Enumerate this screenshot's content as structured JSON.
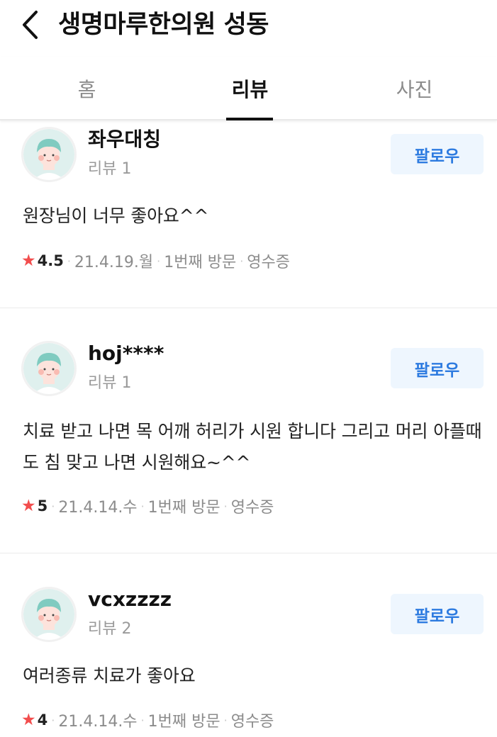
{
  "header": {
    "title": "생명마루한의원 성동"
  },
  "tabs": [
    {
      "label": "홈"
    },
    {
      "label": "리뷰"
    },
    {
      "label": "사진"
    }
  ],
  "reviews": [
    {
      "username": "좌우대칭",
      "review_count": "리뷰 1",
      "follow_label": "팔로우",
      "text": "원장님이 너무 좋아요^^",
      "rating": "4.5",
      "date": "21.4.19.월",
      "visit": "1번째 방문",
      "receipt": "영수증"
    },
    {
      "username": "hoj****",
      "review_count": "리뷰 1",
      "follow_label": "팔로우",
      "text": "치료 받고 나면 목 어깨 허리가 시원 합니다 그리고 머리 아플때도 침 맞고 나면 시원해요~^^",
      "rating": "5",
      "date": "21.4.14.수",
      "visit": "1번째 방문",
      "receipt": "영수증"
    },
    {
      "username": "vcxzzzz",
      "review_count": "리뷰 2",
      "follow_label": "팔로우",
      "text": "여러종류 치료가 좋아요",
      "rating": "4",
      "date": "21.4.14.수",
      "visit": "1번째 방문",
      "receipt": "영수증"
    }
  ],
  "colors": {
    "accent": "#2d7be0",
    "follow_bg": "#eef6fe",
    "star": "#f24d4d",
    "avatar_hair": "#7fcbc0",
    "avatar_skin": "#fde3dc"
  }
}
